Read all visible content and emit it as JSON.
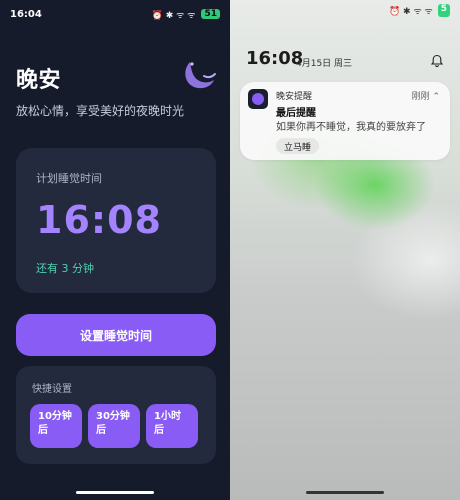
{
  "left": {
    "status": {
      "time": "16:04",
      "icons": "⏰ ✱ ᯤ ᯤ",
      "battery": "51"
    },
    "app": {
      "title": "晚安",
      "subtitle": "放松心情，享受美好的夜晚时光"
    },
    "card": {
      "label": "计划睡觉时间",
      "time": "16:08",
      "remaining": "还有 3 分钟"
    },
    "set_button": "设置睡觉时间",
    "quick": {
      "label": "快捷设置",
      "buttons": [
        "10分钟后",
        "30分钟后",
        "1小时后"
      ]
    }
  },
  "right": {
    "status": {
      "icons": "⏰ ✱ ᯤ ᯤ",
      "battery": "5"
    },
    "lock_time": "16:08",
    "lock_date": "4月15日 周三",
    "notification": {
      "app": "晚安提醒",
      "time": "刚刚",
      "title": "最后提醒",
      "body": "如果你再不睡觉，我真的要放弃了",
      "action": "立马睡"
    }
  },
  "colors": {
    "accent": "#8a5cf6",
    "accent_text": "#a483ff",
    "remaining": "#4fd1b1"
  }
}
